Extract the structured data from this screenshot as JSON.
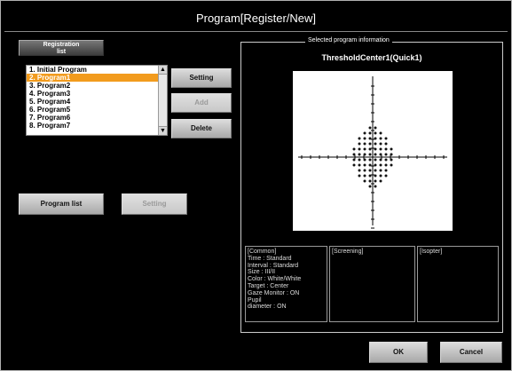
{
  "window": {
    "title": "Program[Register/New]"
  },
  "left": {
    "registration_list_btn": "Registration\nlist",
    "programs": [
      "1. Initial Program",
      "2. Program1",
      "3. Program2",
      "4. Program3",
      "5. Program4",
      "6. Program5",
      "7. Program6",
      "8. Program7"
    ],
    "selected_index": 1,
    "setting_btn": "Setting",
    "add_btn": "Add",
    "delete_btn": "Delete",
    "program_list_btn": "Program list",
    "setting2_btn": "Setting"
  },
  "info": {
    "legend": "Selected program information",
    "program_name": "ThresholdCenter1(Quick1)",
    "panels": [
      {
        "label": "common",
        "text": "[Common]\nTime : Standard\nInterval : Standard\nSize : III/II\nColor : White/White\nTarget : Center\nGaze Monitor : ON\nPupil\ndiameter : ON"
      },
      {
        "label": "screening",
        "text": "[Screening]"
      },
      {
        "label": "isopter",
        "text": "[Isopter]"
      }
    ]
  },
  "footer": {
    "ok_btn": "OK",
    "cancel_btn": "Cancel"
  }
}
